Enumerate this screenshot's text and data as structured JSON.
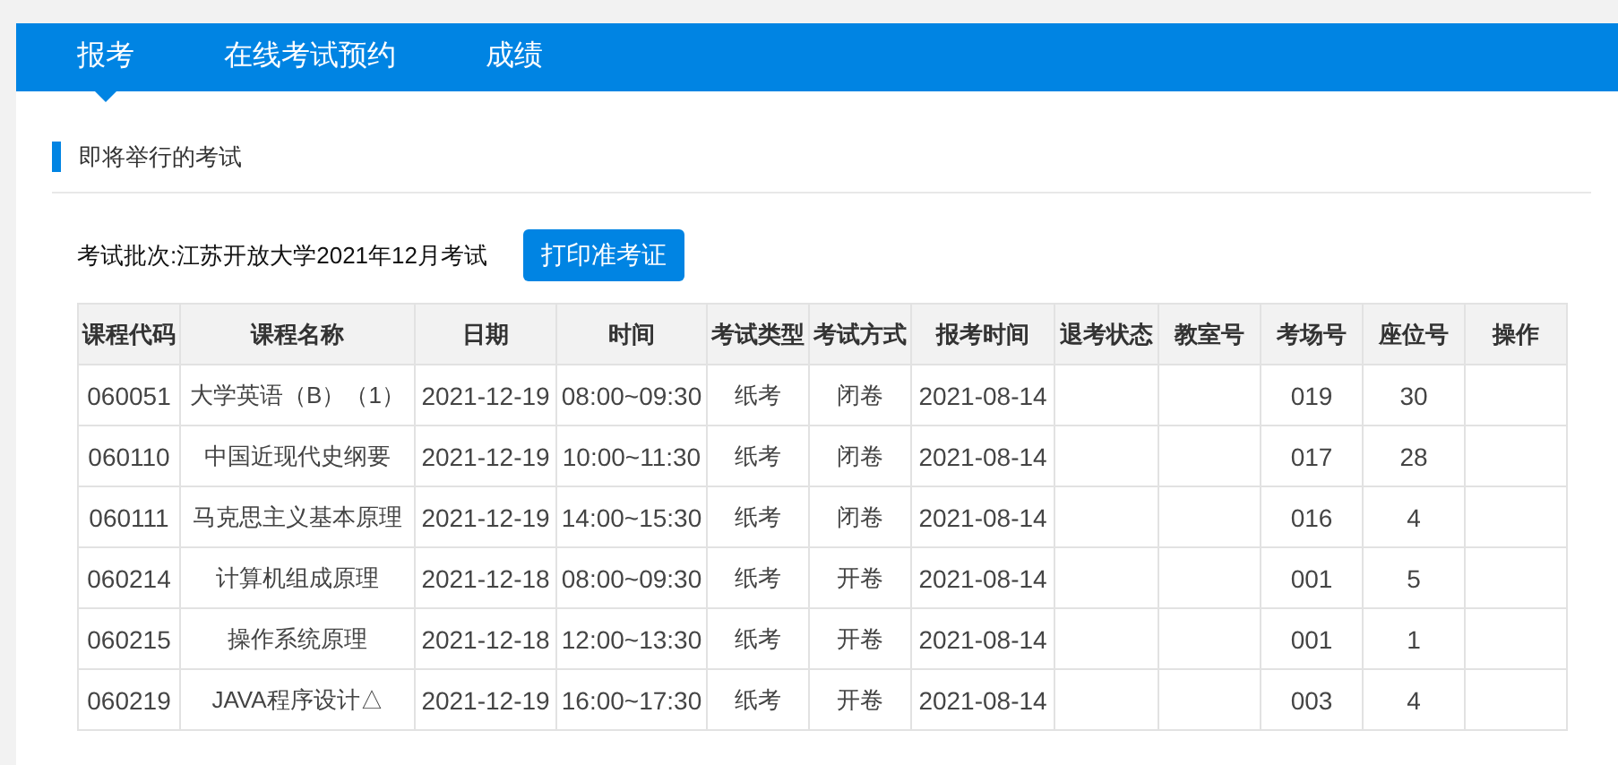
{
  "nav": {
    "tabs": [
      {
        "label": "报考",
        "selected": true
      },
      {
        "label": "在线考试预约",
        "selected": false
      },
      {
        "label": "成绩",
        "selected": false
      }
    ]
  },
  "section": {
    "title": "即将举行的考试"
  },
  "batch": {
    "label": "考试批次:江苏开放大学2021年12月考试",
    "button": "打印准考证"
  },
  "table": {
    "columns": [
      "课程代码",
      "课程名称",
      "日期",
      "时间",
      "考试类型",
      "考试方式",
      "报考时间",
      "退考状态",
      "教室号",
      "考场号",
      "座位号",
      "操作"
    ],
    "rows": [
      [
        "060051",
        "大学英语（B）（1）",
        "2021-12-19",
        "08:00~09:30",
        "纸考",
        "闭卷",
        "2021-08-14",
        null,
        null,
        "019",
        "30",
        null
      ],
      [
        "060110",
        "中国近现代史纲要",
        "2021-12-19",
        "10:00~11:30",
        "纸考",
        "闭卷",
        "2021-08-14",
        null,
        null,
        "017",
        "28",
        null
      ],
      [
        "060111",
        "马克思主义基本原理",
        "2021-12-19",
        "14:00~15:30",
        "纸考",
        "闭卷",
        "2021-08-14",
        null,
        null,
        "016",
        "4",
        null
      ],
      [
        "060214",
        "计算机组成原理",
        "2021-12-18",
        "08:00~09:30",
        "纸考",
        "开卷",
        "2021-08-14",
        null,
        null,
        "001",
        "5",
        null
      ],
      [
        "060215",
        "操作系统原理",
        "2021-12-18",
        "12:00~13:30",
        "纸考",
        "开卷",
        "2021-08-14",
        null,
        null,
        "001",
        "1",
        null
      ],
      [
        "060219",
        "JAVA程序设计△",
        "2021-12-19",
        "16:00~17:30",
        "纸考",
        "开卷",
        "2021-08-14",
        null,
        null,
        "003",
        "4",
        null
      ]
    ]
  }
}
